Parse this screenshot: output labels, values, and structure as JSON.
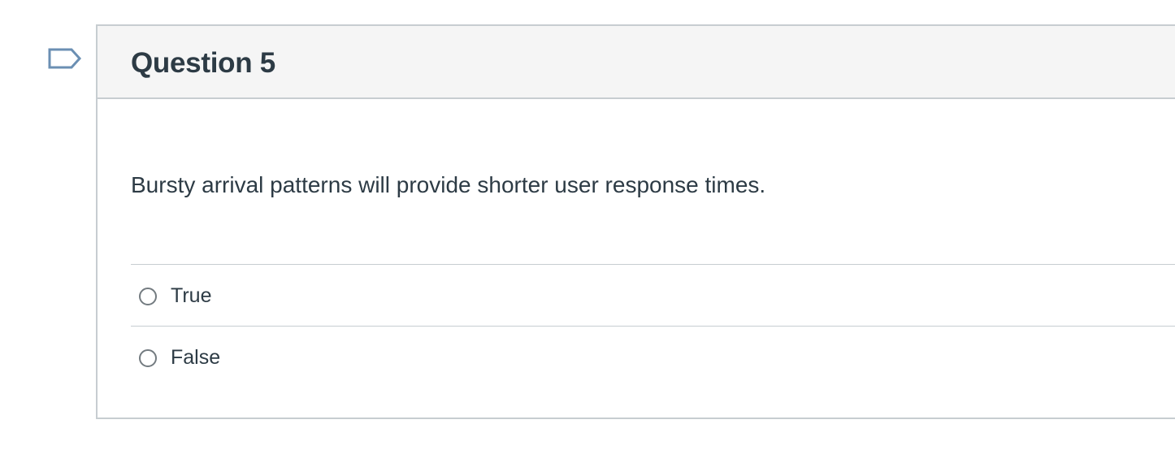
{
  "question": {
    "title": "Question 5",
    "text": "Bursty arrival patterns will provide shorter user response times.",
    "flag_icon": "flag-bookmark-icon",
    "answers": [
      {
        "label": "True",
        "selected": false
      },
      {
        "label": "False",
        "selected": false
      }
    ]
  },
  "colors": {
    "text": "#2d3b45",
    "border": "#c7cdd1",
    "header_bg": "#f5f5f5",
    "flag_stroke": "#6b8fb3"
  }
}
